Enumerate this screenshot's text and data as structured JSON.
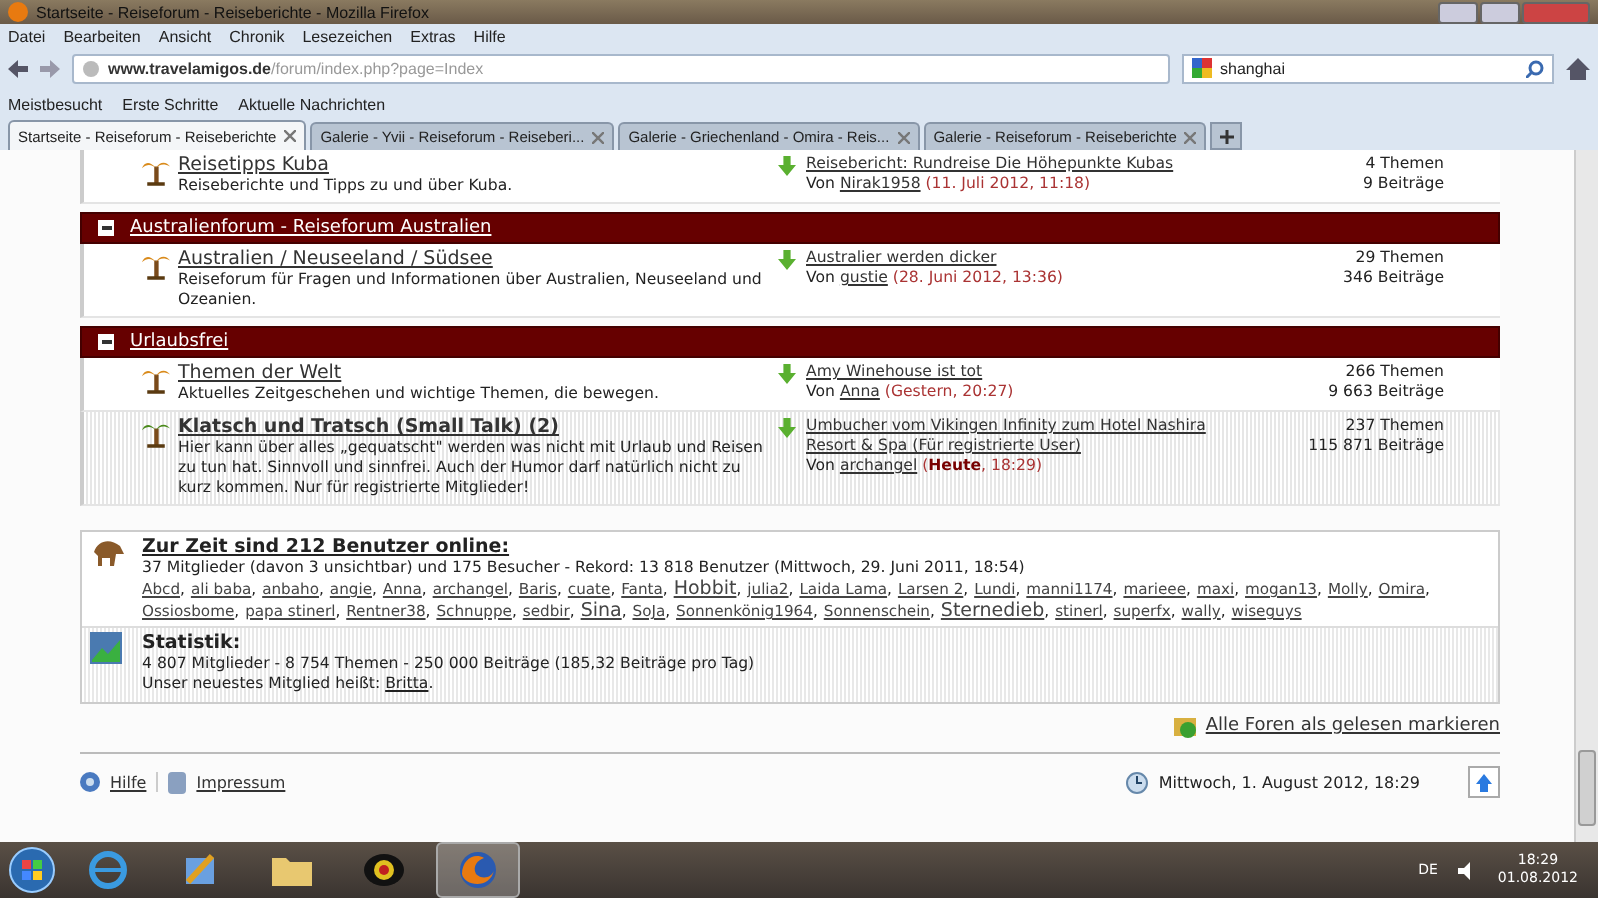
{
  "window": {
    "title": "Startseite - Reiseforum - Reiseberichte - Mozilla Firefox"
  },
  "menu": [
    "Datei",
    "Bearbeiten",
    "Ansicht",
    "Chronik",
    "Lesezeichen",
    "Extras",
    "Hilfe"
  ],
  "navbar": {
    "url_domain": "www.travelamigos.de",
    "url_path": "/forum/index.php?page=Index",
    "search": "shanghai"
  },
  "bookmarks": [
    "Meistbesucht",
    "Erste Schritte",
    "Aktuelle Nachrichten"
  ],
  "tabs": [
    {
      "label": "Startseite - Reiseforum - Reiseberichte",
      "selected": true
    },
    {
      "label": "Galerie - Yvii - Reiseforum - Reiseberi...",
      "selected": false
    },
    {
      "label": "Galerie - Griechenland - Omira - Reis...",
      "selected": false
    },
    {
      "label": "Galerie - Reiseforum - Reiseberichte",
      "selected": false
    }
  ],
  "sections": [
    {
      "forums": [
        {
          "title": "Reisetipps Kuba",
          "description": "Reiseberichte und Tipps zu und über Kuba.",
          "unread": false,
          "last_post": {
            "title": "Reisebericht: Rundreise Die Höhepunkte Kubas",
            "prefix": "Von",
            "author": "Nirak1958",
            "date": "(11. Juli 2012, 11:18)"
          },
          "topics": "4 Themen",
          "posts": "9 Beiträge"
        }
      ]
    },
    {
      "title": "Australienforum - Reiseforum Australien",
      "forums": [
        {
          "title": "Australien / Neuseeland / Südsee",
          "description": "Reiseforum für Fragen und Informationen über Australien, Neuseeland und Ozeanien.",
          "unread": false,
          "last_post": {
            "title": "Australier werden dicker",
            "prefix": "Von",
            "author": "gustie",
            "date": "(28. Juni 2012, 13:36)"
          },
          "topics": "29 Themen",
          "posts": "346 Beiträge"
        }
      ]
    },
    {
      "title": "Urlaubsfrei",
      "forums": [
        {
          "title": "Themen der Welt",
          "description": "Aktuelles Zeitgeschehen und wichtige Themen, die bewegen.",
          "unread": false,
          "last_post": {
            "title": "Amy Winehouse ist tot",
            "prefix": "Von",
            "author": "Anna",
            "date": "(Gestern, 20:27)"
          },
          "topics": "266 Themen",
          "posts": "9 663 Beiträge"
        },
        {
          "title": "Klatsch und Tratsch (Small Talk) (2)",
          "description": "Hier kann über alles „gequatscht\" werden was nicht mit Urlaub und Reisen zu tun hat. Sinnvoll und sinnfrei. Auch der Humor darf natürlich nicht zu kurz kommen. Nur für registrierte Mitglieder!",
          "unread": true,
          "last_post": {
            "title": "Umbucher vom Vikingen Infinity zum Hotel Nashira Resort & Spa (Für registrierte User)",
            "prefix": "Von",
            "author": "archangel",
            "date": "(**Heute**, 18:29)"
          },
          "topics": "237 Themen",
          "posts": "115 871 Beiträge"
        }
      ]
    }
  ],
  "online": {
    "heading": "Zur Zeit sind 212 Benutzer online:",
    "summary": "37 Mitglieder (davon 3 unsichtbar) und 175 Besucher - Rekord: 13 818 Benutzer (Mittwoch, 29. Juni 2011, 18:54)",
    "users": [
      {
        "name": "Abcd",
        "large": false
      },
      {
        "name": "ali baba",
        "large": false
      },
      {
        "name": "anbaho",
        "large": false
      },
      {
        "name": "angie",
        "large": false
      },
      {
        "name": "Anna",
        "large": false
      },
      {
        "name": "archangel",
        "large": false
      },
      {
        "name": "Baris",
        "large": false
      },
      {
        "name": "cuate",
        "large": false
      },
      {
        "name": "Fanta",
        "large": false
      },
      {
        "name": "Hobbit",
        "large": true
      },
      {
        "name": "julia2",
        "large": false
      },
      {
        "name": "Laida Lama",
        "large": false
      },
      {
        "name": "Larsen 2",
        "large": false
      },
      {
        "name": "Lundi",
        "large": false
      },
      {
        "name": "manni1174",
        "large": false
      },
      {
        "name": "marieee",
        "large": false
      },
      {
        "name": "maxi",
        "large": false
      },
      {
        "name": "mogan13",
        "large": false
      },
      {
        "name": "Molly",
        "large": false
      },
      {
        "name": "Omira",
        "large": false
      },
      {
        "name": "Ossiosbome",
        "large": false
      },
      {
        "name": "papa stinerl",
        "large": false
      },
      {
        "name": "Rentner38",
        "large": false
      },
      {
        "name": "Schnuppe",
        "large": false
      },
      {
        "name": "sedbir",
        "large": false
      },
      {
        "name": "Sina",
        "large": true
      },
      {
        "name": "SoJa",
        "large": false
      },
      {
        "name": "Sonnenkönig1964",
        "large": false
      },
      {
        "name": "Sonnenschein",
        "large": false
      },
      {
        "name": "Sternedieb",
        "large": true
      },
      {
        "name": "stinerl",
        "large": false
      },
      {
        "name": "superfx",
        "large": false
      },
      {
        "name": "wally",
        "large": false
      },
      {
        "name": "wiseguys",
        "large": false
      }
    ],
    "separator": ","
  },
  "statistics": {
    "heading": "Statistik:",
    "summary": "4 807 Mitglieder - 8 754 Themen - 250 000 Beiträge (185,32 Beiträge pro Tag)",
    "newest_label": "Unser neuestes Mitglied heißt:",
    "newest_member": "Britta",
    "newest_suffix": "."
  },
  "mark_all_read": "Alle Foren als gelesen markieren",
  "footer": {
    "links": [
      {
        "label": "Hilfe",
        "kind": "help"
      },
      {
        "label": "Impressum",
        "kind": "imprint"
      }
    ],
    "datetime": "Mittwoch, 1. August 2012, 18:29"
  },
  "taskbar": {
    "apps": [
      {
        "kind": "ie",
        "selected": false
      },
      {
        "kind": "paint",
        "selected": false
      },
      {
        "kind": "folder",
        "selected": false
      },
      {
        "kind": "media",
        "selected": false
      },
      {
        "kind": "firefox",
        "selected": true
      }
    ],
    "language": "DE",
    "time": "18:29",
    "date": "01.08.2012"
  }
}
